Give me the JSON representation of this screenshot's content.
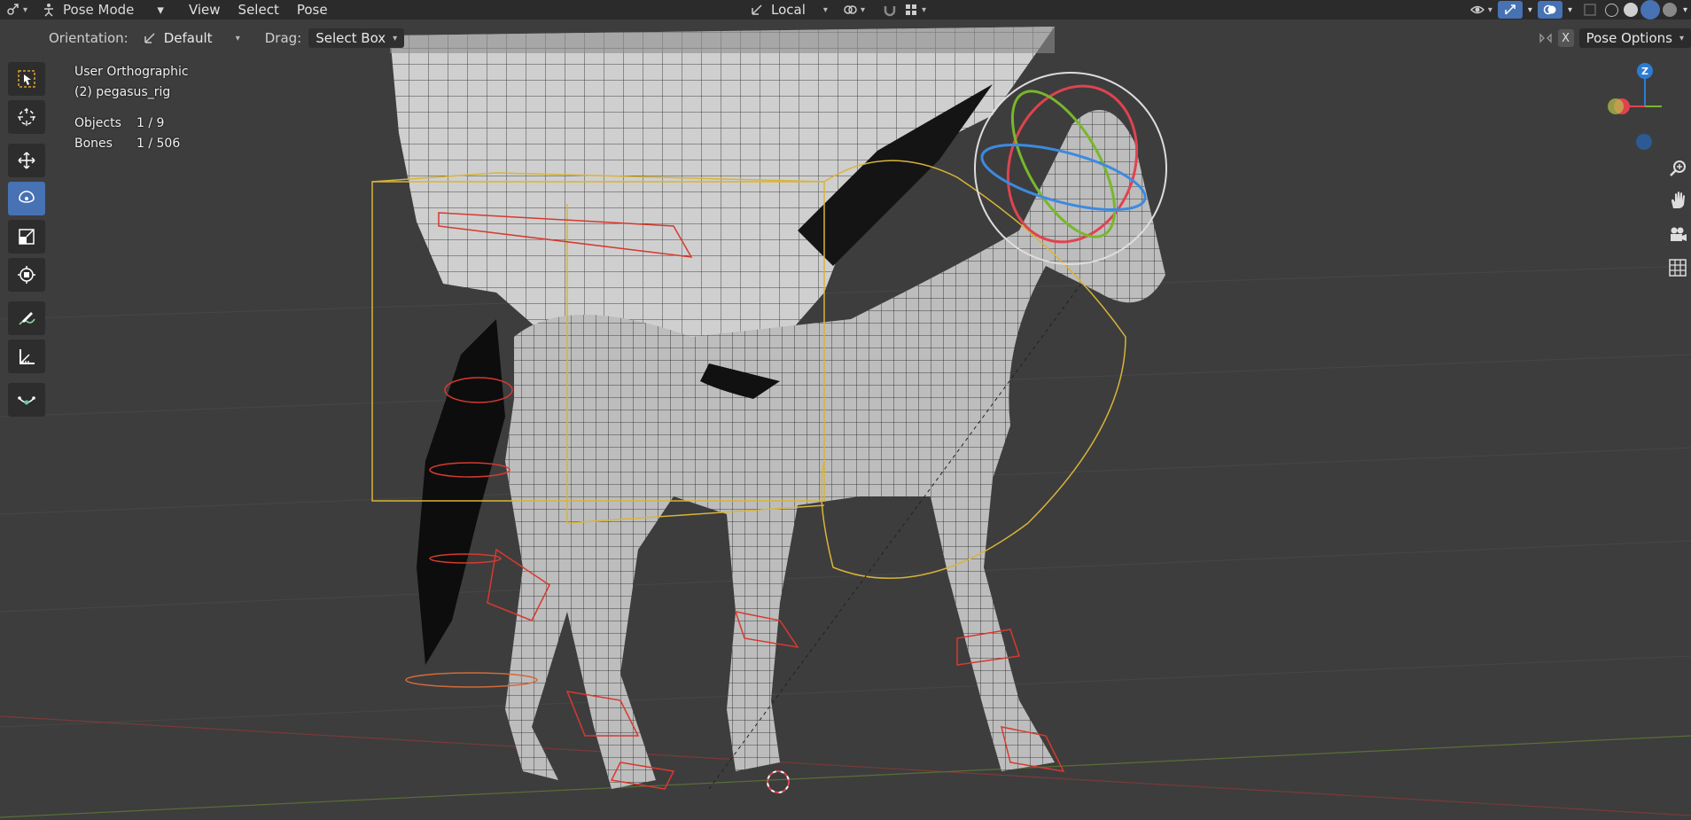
{
  "header": {
    "mode_label": "Pose Mode",
    "menus": [
      "View",
      "Select",
      "Pose"
    ],
    "transform_orientation": "Local"
  },
  "tool_settings": {
    "orientation_label": "Orientation:",
    "orientation_value": "Default",
    "drag_label": "Drag:",
    "drag_value": "Select Box",
    "x_badge": "X",
    "pose_options_label": "Pose Options"
  },
  "overlay": {
    "view_name": "User Orthographic",
    "object_name": "(2) pegasus_rig",
    "objects_label": "Objects",
    "objects_value": "1 / 9",
    "bones_label": "Bones",
    "bones_value": "1 / 506"
  },
  "gizmo": {
    "z_label": "Z"
  },
  "tools": [
    "select-box-tool",
    "cursor-tool",
    "move-tool",
    "rotate-tool",
    "scale-tool",
    "transform-tool",
    "annotate-tool",
    "measure-tool",
    "relax-pose-tool"
  ],
  "colors": {
    "accent": "#4772b3",
    "axis_x": "#e0434f",
    "axis_y": "#78b72b",
    "axis_z": "#2c7cd4",
    "bone_red": "#d63a2f",
    "bone_yellow": "#d8b43a"
  }
}
